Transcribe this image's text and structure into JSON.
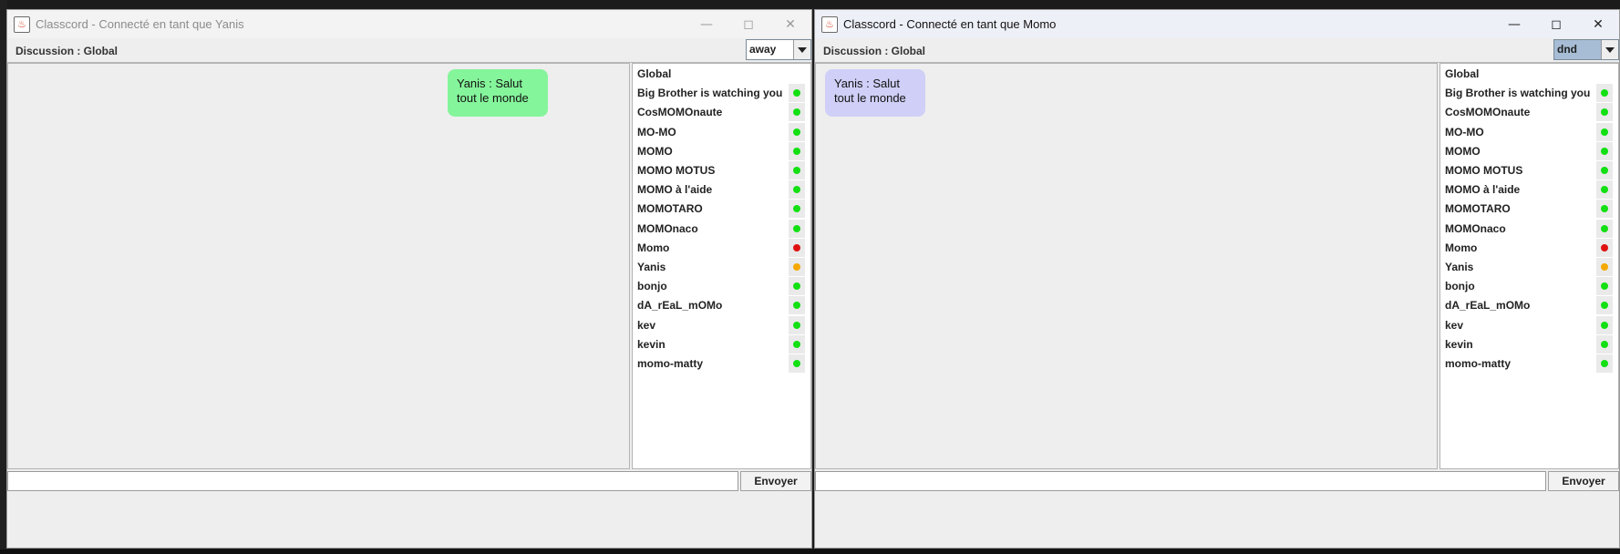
{
  "status_colors": {
    "online": "#13e013",
    "busy": "#e01010",
    "away": "#f5a800"
  },
  "windows": [
    {
      "id": "yanis",
      "title": "Classcord - Connecté en tant que Yanis",
      "discussion_label": "Discussion : Global",
      "status": "away",
      "message": "Yanis : Salut tout le monde",
      "input_value": "",
      "send_label": "Envoyer",
      "users": [
        {
          "name": "Global",
          "status": ""
        },
        {
          "name": "Big Brother is watching you",
          "status": "online"
        },
        {
          "name": "CosMOMOnaute",
          "status": "online"
        },
        {
          "name": "MO-MO",
          "status": "online"
        },
        {
          "name": "MOMO",
          "status": "online"
        },
        {
          "name": "MOMO MOTUS",
          "status": "online"
        },
        {
          "name": "MOMO à l'aide",
          "status": "online"
        },
        {
          "name": "MOMOTARO",
          "status": "online"
        },
        {
          "name": "MOMOnaco",
          "status": "online"
        },
        {
          "name": "Momo",
          "status": "busy"
        },
        {
          "name": "Yanis",
          "status": "away"
        },
        {
          "name": "bonjo",
          "status": "online"
        },
        {
          "name": "dA_rEaL_mOMo",
          "status": "online"
        },
        {
          "name": "kev",
          "status": "online"
        },
        {
          "name": "kevin",
          "status": "online"
        },
        {
          "name": "momo-matty",
          "status": "online"
        }
      ]
    },
    {
      "id": "momo",
      "title": "Classcord - Connecté en tant que Momo",
      "discussion_label": "Discussion : Global",
      "status": "dnd",
      "message": "Yanis : Salut tout le monde",
      "input_value": "",
      "send_label": "Envoyer",
      "users": [
        {
          "name": "Global",
          "status": ""
        },
        {
          "name": "Big Brother is watching you",
          "status": "online"
        },
        {
          "name": "CosMOMOnaute",
          "status": "online"
        },
        {
          "name": "MO-MO",
          "status": "online"
        },
        {
          "name": "MOMO",
          "status": "online"
        },
        {
          "name": "MOMO MOTUS",
          "status": "online"
        },
        {
          "name": "MOMO à l'aide",
          "status": "online"
        },
        {
          "name": "MOMOTARO",
          "status": "online"
        },
        {
          "name": "MOMOnaco",
          "status": "online"
        },
        {
          "name": "Momo",
          "status": "busy"
        },
        {
          "name": "Yanis",
          "status": "away"
        },
        {
          "name": "bonjo",
          "status": "online"
        },
        {
          "name": "dA_rEaL_mOMo",
          "status": "online"
        },
        {
          "name": "kev",
          "status": "online"
        },
        {
          "name": "kevin",
          "status": "online"
        },
        {
          "name": "momo-matty",
          "status": "online"
        }
      ]
    }
  ]
}
